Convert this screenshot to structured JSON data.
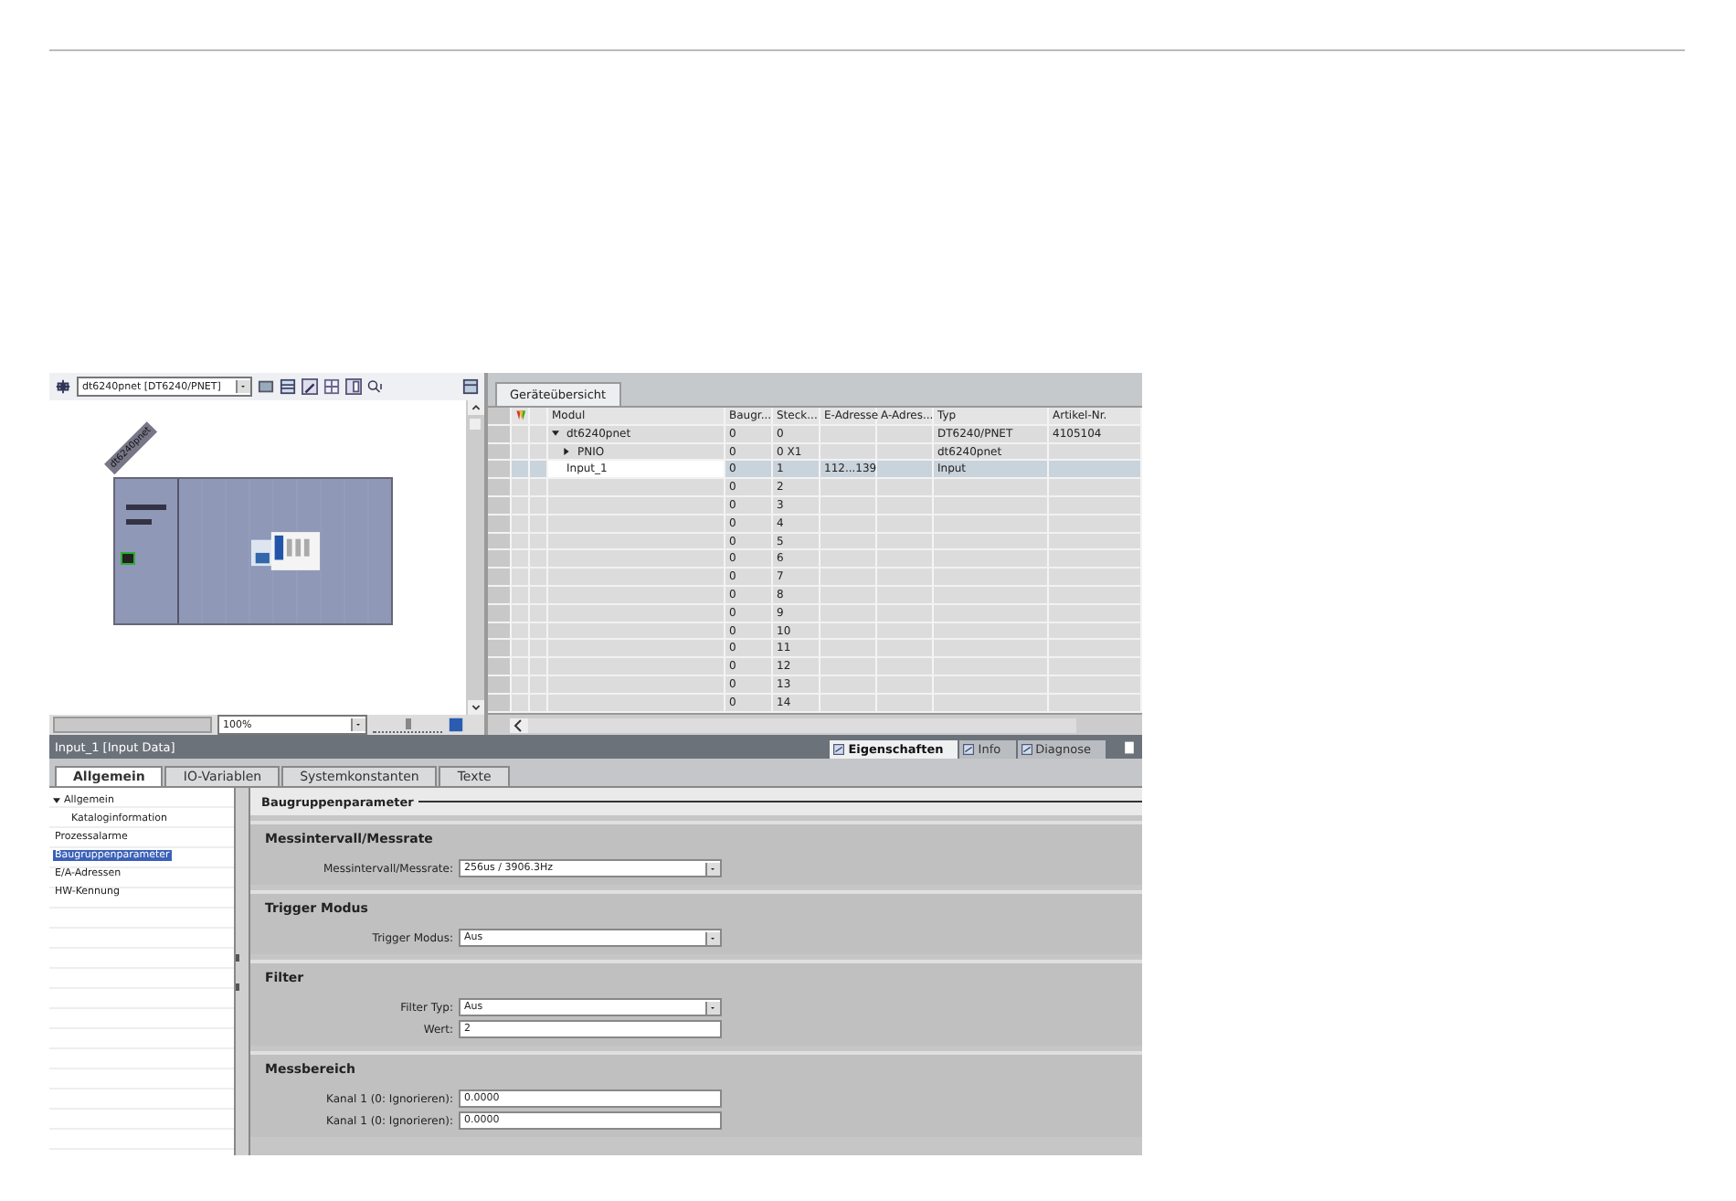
{
  "device_view": {
    "device_dropdown": "dt6240pnet [DT6240/PNET]",
    "device_label": "dt6240pnet",
    "zoom": "100%",
    "zoom_slider": {
      "level": 0.5
    }
  },
  "overview": {
    "tab": "Geräteübersicht",
    "columns": [
      "Modul",
      "Baugr...",
      "Steck...",
      "E-Adresse",
      "A-Adres...",
      "Typ",
      "Artikel-Nr."
    ],
    "rows": [
      {
        "modul": "dt6240pnet",
        "expanded": true,
        "selected": false,
        "baugr": "0",
        "steck": "0",
        "typ": "DT6240/PNET",
        "artikel": "4105104",
        "children": [
          {
            "modul": "PNIO",
            "expanded": false,
            "selected": false,
            "baugr": "0",
            "steck": "0 X1",
            "typ": "dt6240pnet"
          }
        ]
      },
      {
        "modul": "Input_1",
        "selected": true,
        "baugr": "0",
        "steck": "1",
        "e_adresse": "112...139",
        "typ": "Input"
      },
      {
        "selected": false,
        "baugr": "0",
        "steck": "2"
      },
      {
        "selected": false,
        "baugr": "0",
        "steck": "3"
      },
      {
        "selected": false,
        "baugr": "0",
        "steck": "4"
      },
      {
        "selected": false,
        "baugr": "0",
        "steck": "5"
      },
      {
        "selected": false,
        "baugr": "0",
        "steck": "6"
      },
      {
        "selected": false,
        "baugr": "0",
        "steck": "7"
      },
      {
        "selected": false,
        "baugr": "0",
        "steck": "8"
      },
      {
        "selected": false,
        "baugr": "0",
        "steck": "9"
      },
      {
        "selected": false,
        "baugr": "0",
        "steck": "10"
      },
      {
        "selected": false,
        "baugr": "0",
        "steck": "11"
      },
      {
        "selected": false,
        "baugr": "0",
        "steck": "12"
      },
      {
        "selected": false,
        "baugr": "0",
        "steck": "13"
      },
      {
        "selected": false,
        "baugr": "0",
        "steck": "14"
      }
    ]
  },
  "properties": {
    "title": "Input_1 [Input Data]",
    "view_tabs": [
      {
        "label": "Eigenschaften",
        "selected": true
      },
      {
        "label": "Info",
        "selected": false
      },
      {
        "label": "Diagnose",
        "selected": false
      }
    ],
    "tabs": [
      {
        "label": "Allgemein",
        "selected": true
      },
      {
        "label": "IO-Variablen",
        "selected": false
      },
      {
        "label": "Systemkonstanten",
        "selected": false
      },
      {
        "label": "Texte",
        "selected": false
      }
    ],
    "nav": [
      {
        "label": "Allgemein",
        "expanded": true,
        "selected": false,
        "children": [
          {
            "label": "Kataloginformation",
            "selected": false
          }
        ]
      },
      {
        "label": "Prozessalarme",
        "selected": false
      },
      {
        "label": "Baugruppenparameter",
        "selected": true
      },
      {
        "label": "E/A-Adressen",
        "selected": false
      },
      {
        "label": "HW-Kennung",
        "selected": false
      }
    ],
    "heading": "Baugruppenparameter",
    "sections": [
      {
        "title": "Messintervall/Messrate",
        "fields": [
          {
            "label": "Messintervall/Messrate:",
            "value": "256us / 3906.3Hz",
            "kind": "dropdown"
          }
        ]
      },
      {
        "title": "Trigger Modus",
        "fields": [
          {
            "label": "Trigger Modus:",
            "value": "Aus",
            "kind": "dropdown"
          }
        ]
      },
      {
        "title": "Filter",
        "fields": [
          {
            "label": "Filter Typ:",
            "value": "Aus",
            "kind": "dropdown"
          },
          {
            "label": "Wert:",
            "value": "2",
            "kind": "text"
          }
        ]
      },
      {
        "title": "Messbereich",
        "fields": [
          {
            "label": "Kanal 1 (0: Ignorieren):",
            "value": "0.0000",
            "kind": "text"
          },
          {
            "label": "Kanal 1 (0: Ignorieren):",
            "value": "0.0000",
            "kind": "text"
          }
        ]
      }
    ]
  }
}
